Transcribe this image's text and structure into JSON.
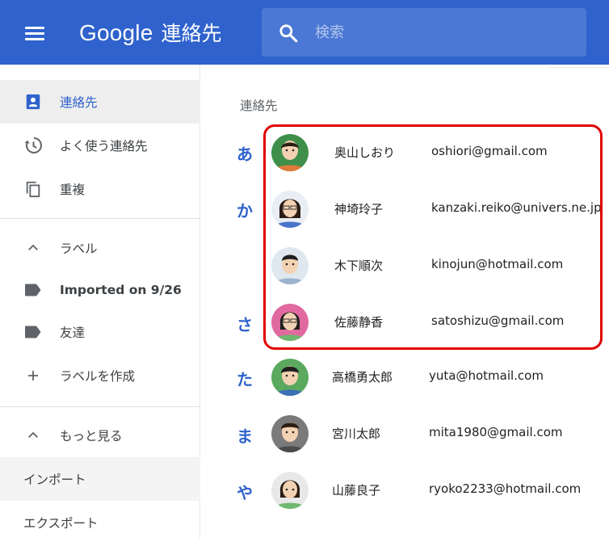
{
  "header": {
    "logo_google": "Google",
    "logo_product": "連絡先",
    "search_placeholder": "検索",
    "color": "#2f62cc"
  },
  "sidebar": {
    "items": [
      {
        "label": "連絡先",
        "icon": "contacts-icon",
        "active": true
      },
      {
        "label": "よく使う連絡先",
        "icon": "history-icon"
      },
      {
        "label": "重複",
        "icon": "copy-icon"
      },
      {
        "label": "ラベル",
        "icon": "chevron-up-icon"
      },
      {
        "label": "Imported on 9/26",
        "icon": "label-icon"
      },
      {
        "label": "友達",
        "icon": "label-icon"
      },
      {
        "label": "ラベルを作成",
        "icon": "plus-icon"
      },
      {
        "label": "もっと見る",
        "icon": "chevron-up-icon"
      },
      {
        "label": "インポート"
      },
      {
        "label": "エクスポート"
      }
    ]
  },
  "main": {
    "section_title": "連絡先",
    "letters": [
      "あ",
      "か",
      "さ",
      "た",
      "ま",
      "や"
    ],
    "contacts": [
      {
        "name": "奥山しおり",
        "email": "oshiori@gmail.com",
        "avatar_bg": "#3f8f4a"
      },
      {
        "name": "神埼玲子",
        "email": "kanzaki.reiko@univers.ne.jp",
        "avatar_bg": "#4a74c9"
      },
      {
        "name": "木下順次",
        "email": "kinojun@hotmail.com",
        "avatar_bg": "#dfe7ef"
      },
      {
        "name": "佐藤静香",
        "email": "satoshizu@gmail.com",
        "avatar_bg": "#e06aa0"
      },
      {
        "name": "高橋勇太郎",
        "email": "yuta@hotmail.com",
        "avatar_bg": "#5aa95f"
      },
      {
        "name": "宮川太郎",
        "email": "mita1980@gmail.com",
        "avatar_bg": "#7a7a7a"
      },
      {
        "name": "山藤良子",
        "email": "ryoko2233@hotmail.com",
        "avatar_bg": "#e8e8e8"
      }
    ]
  },
  "annotation": {
    "color": "#e00000"
  }
}
